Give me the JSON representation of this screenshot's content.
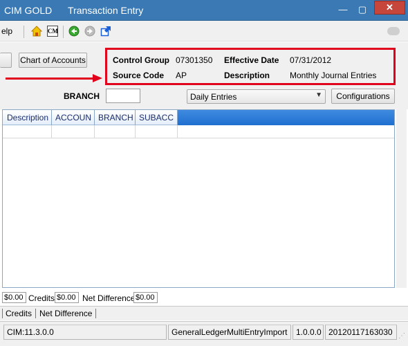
{
  "window": {
    "app_name": "CIM GOLD",
    "title": "Transaction Entry",
    "minimize_glyph": "—",
    "maximize_glyph": "▢",
    "close_glyph": "✕"
  },
  "menu": {
    "help_label": "elp"
  },
  "toolbar": {
    "icons": [
      "home-icon",
      "cim-icon",
      "back-arrow-icon",
      "forward-arrow-icon",
      "popout-icon",
      "cloud-icon"
    ],
    "cim_text": "CM"
  },
  "form": {
    "chart_button": "Chart of Accounts",
    "control_group_label": "Control Group",
    "control_group_value": "07301350",
    "effective_date_label": "Effective Date",
    "effective_date_value": "07/31/2012",
    "source_code_label": "Source Code",
    "source_code_value": "AP",
    "description_label": "Description",
    "description_value": "Monthly Journal Entries",
    "branch_label": "BRANCH",
    "branch_value": "",
    "entry_type_selected": "Daily Entries",
    "configurations_button": "Configurations"
  },
  "grid": {
    "columns": [
      "Description",
      "ACCOUN",
      "BRANCH",
      "SUBACC"
    ]
  },
  "totals": {
    "debits_value": "$0.00",
    "credits_label": "Credits",
    "credits_value": "$0.00",
    "net_label": "Net Difference",
    "net_value": "$0.00"
  },
  "tabs": [
    "Credits",
    "Net Difference"
  ],
  "status": {
    "version": "CIM:11.3.0.0",
    "module": "GeneralLedgerMultiEntryImport",
    "module_version": "1.0.0.0",
    "build": "20120117163030"
  },
  "colors": {
    "titlebar": "#3a79b3",
    "highlight_red": "#e0001b",
    "grid_header_blue": "#1f6fd0"
  }
}
